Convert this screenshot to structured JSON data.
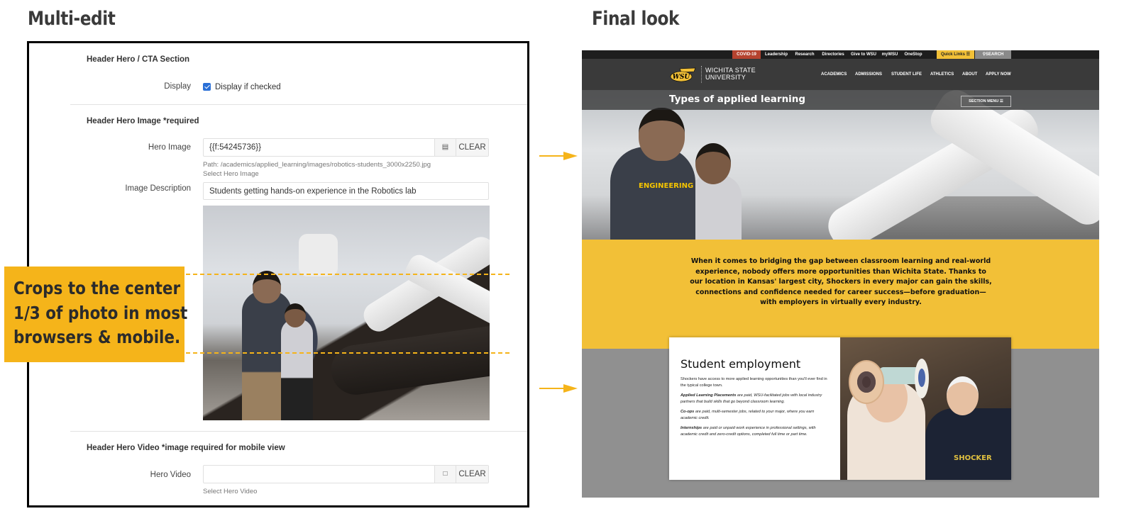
{
  "headings": {
    "left": "Multi-edit",
    "right": "Final look"
  },
  "cms": {
    "section_cta": "Header Hero / CTA Section",
    "display_label": "Display",
    "display_checkbox_label": "Display if checked",
    "display_checked": true,
    "section_image": "Header Hero Image *required",
    "hero_image_label": "Hero Image",
    "hero_image_value": "{{f:54245736}}",
    "hero_image_icon": "image-icon",
    "clear_label": "CLEAR",
    "hero_image_path": "Path: /academics/applied_learning/images/robotics-students_3000x2250.jpg",
    "hero_image_help": "Select Hero Image",
    "image_description_label": "Image Description",
    "image_description_value": "Students getting hands-on experience in the Robotics lab",
    "section_video": "Header Hero Video *image required for mobile view",
    "hero_video_label": "Hero Video",
    "hero_video_value": "",
    "hero_video_icon": "file-icon",
    "hero_video_help": "Select Hero Video"
  },
  "callout": {
    "lines": [
      "Crops to the center",
      "1/3 of photo in most",
      "browsers & mobile."
    ],
    "color": "#f5b41a"
  },
  "site": {
    "topbar": [
      "COVID-19",
      "Leadership",
      "Research",
      "Directories",
      "Give to WSU",
      "myWSU",
      "OneStop"
    ],
    "quick_links": "Quick Links",
    "search": "SEARCH",
    "logo_text_1": "WICHITA STATE",
    "logo_text_2": "UNIVERSITY",
    "logo_mark": "WSU",
    "nav": [
      "ACADEMICS",
      "ADMISSIONS",
      "STUDENT LIFE",
      "ATHLETICS",
      "ABOUT",
      "APPLY NOW"
    ],
    "hero_title": "Types of applied learning",
    "section_menu": "SECTION MENU",
    "hero_shirt": "ENGINEERING",
    "intro": "When it comes to bridging the gap between classroom learning and real-world experience, nobody offers more opportunities than Wichita State. Thanks to our location in Kansas' largest city, Shockers in every major can gain the skills, connections and confidence needed for career success—before graduation—with employers in virtually every industry.",
    "card": {
      "title": "Student employment",
      "p1": "Shockers have access to more applied learning opportunities than you'll ever find in the typical college town.",
      "p2_bold": "Applied Learning Placements",
      "p2_rest": " are paid, WSU-facilitated jobs with local industry partners that build skills that go beyond classroom learning.",
      "p3_bold": "Co-ops",
      "p3_rest": " are paid, multi-semester jobs, related to your major, where you earn academic credit.",
      "p4_bold": "Internships",
      "p4_rest": " are paid or unpaid work experience in professional settings, with academic credit and zero-credit options, completed full time or part time.",
      "photo_shirt": "SHOCKER"
    },
    "colors": {
      "covid": "#b5432f",
      "quick_links": "#f2c037",
      "search": "#8a8a8a",
      "yellow": "#f2c037"
    }
  }
}
